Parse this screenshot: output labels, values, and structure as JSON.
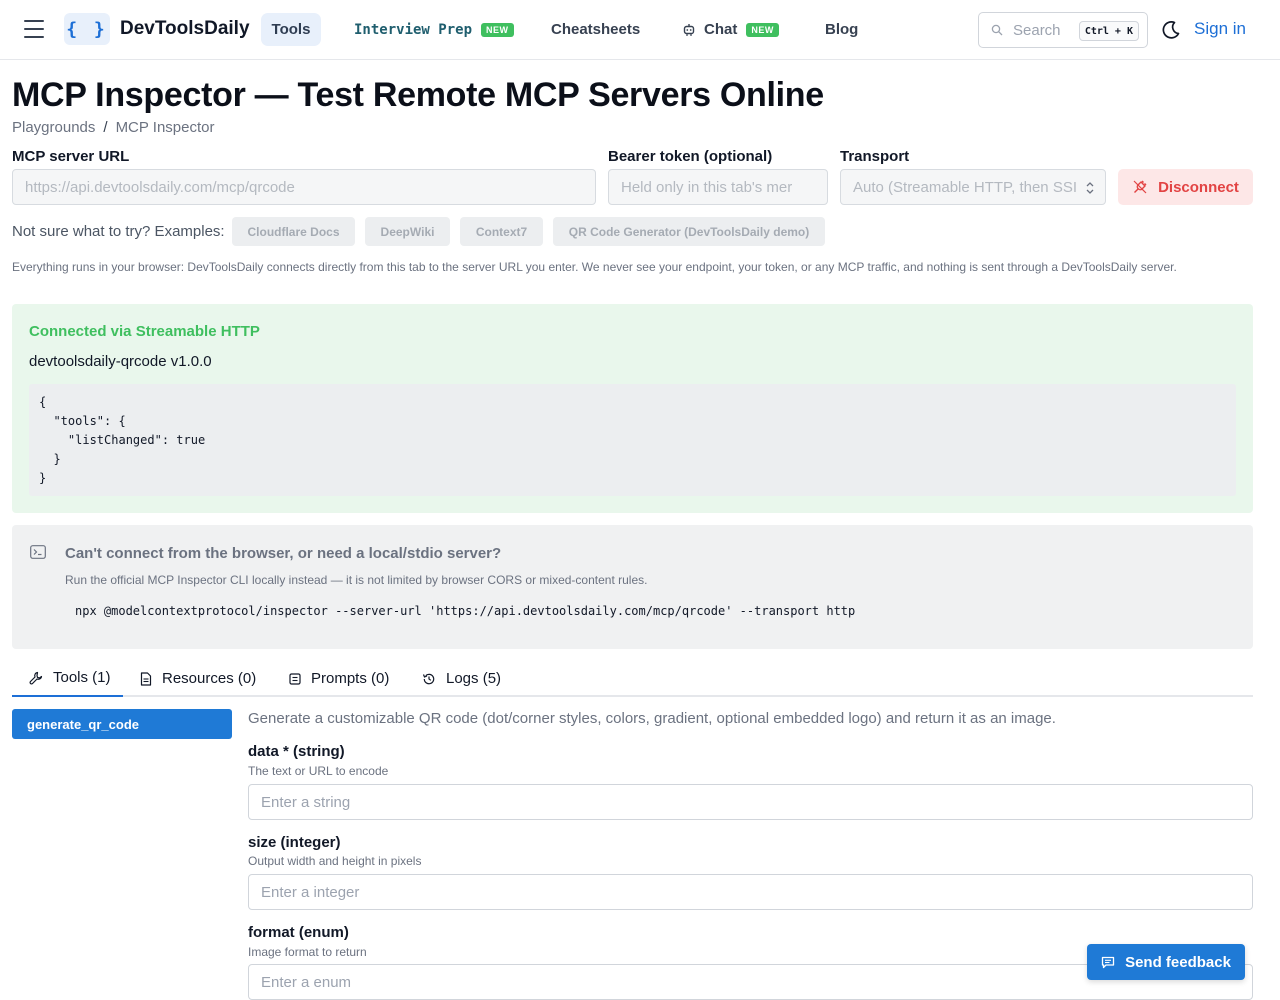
{
  "header": {
    "logo_glyph": "{ }",
    "logo_main": "DevToolsDaily",
    "nav": {
      "tools": "Tools",
      "interview_prep": "Interview Prep",
      "interview_badge": "NEW",
      "cheatsheets": "Cheatsheets",
      "chat": "Chat",
      "chat_badge": "NEW",
      "blog": "Blog"
    },
    "search_placeholder": "Search",
    "search_shortcut": "Ctrl + K",
    "sign_in": "Sign in"
  },
  "page": {
    "title": "MCP Inspector — Test Remote MCP Servers Online",
    "breadcrumb": [
      "Playgrounds",
      "MCP Inspector"
    ],
    "breadcrumb_sep": "/"
  },
  "form": {
    "server_url_label": "MCP server URL",
    "server_url_value": "https://api.devtoolsdaily.com/mcp/qrcode",
    "token_label": "Bearer token (optional)",
    "token_placeholder": "Held only in this tab's mer",
    "transport_label": "Transport",
    "transport_value": "Auto (Streamable HTTP, then SSI",
    "disconnect_label": "Disconnect"
  },
  "examples": {
    "label": "Not sure what to try? Examples:",
    "items": [
      "Cloudflare Docs",
      "DeepWiki",
      "Context7",
      "QR Code Generator (DevToolsDaily demo)"
    ]
  },
  "privacy_note": "Everything runs in your browser: DevToolsDaily connects directly from this tab to the server URL you enter. We never see your endpoint, your token, or any MCP traffic, and nothing is sent through a DevToolsDaily server.",
  "connection": {
    "status": "Connected via Streamable HTTP",
    "server": "devtoolsdaily-qrcode v1.0.0",
    "capabilities_json": "{\n  \"tools\": {\n    \"listChanged\": true\n  }\n}"
  },
  "cli": {
    "title": "Can't connect from the browser, or need a local/stdio server?",
    "description": "Run the official MCP Inspector CLI locally instead — it is not limited by browser CORS or mixed-content rules.",
    "command": "npx @modelcontextprotocol/inspector --server-url 'https://api.devtoolsdaily.com/mcp/qrcode' --transport http"
  },
  "tabs": {
    "tools": "Tools (1)",
    "resources": "Resources (0)",
    "prompts": "Prompts (0)",
    "logs": "Logs (5)"
  },
  "tool_list": [
    "generate_qr_code"
  ],
  "tool_detail": {
    "description": "Generate a customizable QR code (dot/corner styles, colors, gradient, optional embedded logo) and return it as an image.",
    "params": [
      {
        "label": "data * (string)",
        "help": "The text or URL to encode",
        "placeholder": "Enter a string"
      },
      {
        "label": "size (integer)",
        "help": "Output width and height in pixels",
        "placeholder": "Enter a integer"
      },
      {
        "label": "format (enum)",
        "help": "Image format to return",
        "placeholder": "Enter a enum"
      }
    ]
  },
  "feedback_label": "Send feedback",
  "colors": {
    "accent": "#1d6fd6",
    "success": "#3fbf5f",
    "danger": "#e24343"
  },
  "icons": [
    "menu-icon",
    "search-icon",
    "moon-icon",
    "chat-bot-icon",
    "unplug-icon",
    "terminal-icon",
    "wrench-icon",
    "file-icon",
    "prompt-icon",
    "history-icon",
    "message-icon",
    "chevron-updown-icon"
  ]
}
